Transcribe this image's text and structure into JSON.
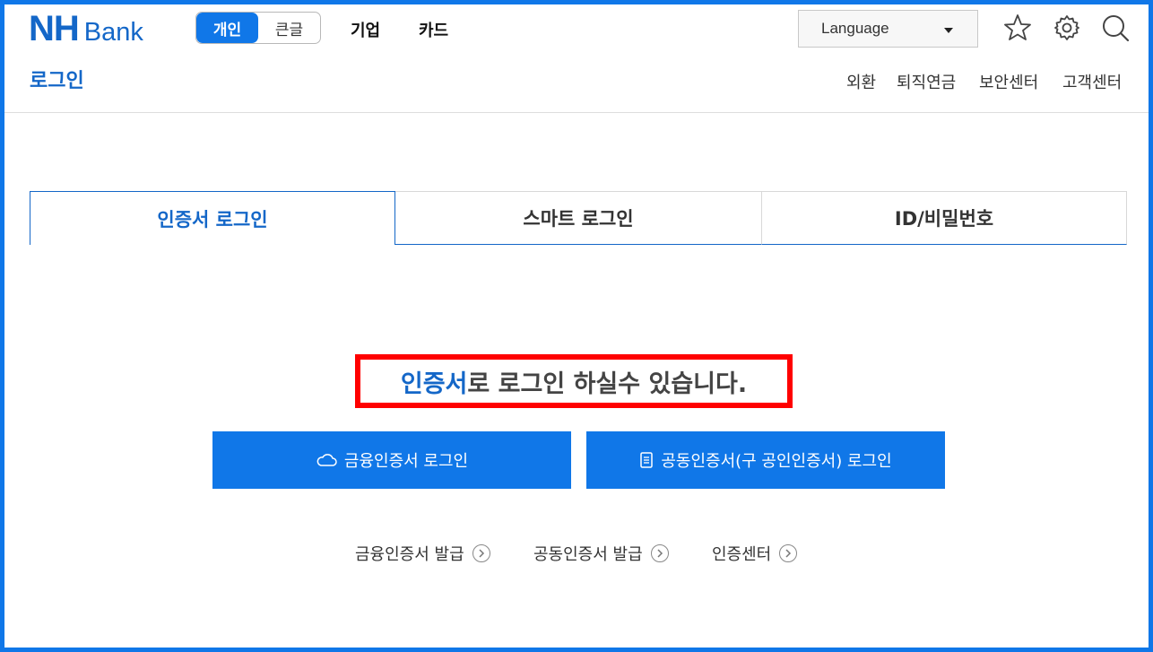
{
  "header": {
    "logo_nh": "NH",
    "logo_bank": "Bank",
    "segment": {
      "active": "개인",
      "inactive": "큰글"
    },
    "top_menu": [
      "기업",
      "카드"
    ],
    "language": {
      "label": "Language"
    },
    "icons": [
      "star-icon",
      "gear-icon",
      "search-icon"
    ],
    "page_title": "로그인",
    "sub_menu": [
      "외환",
      "퇴직연금",
      "보안센터",
      "고객센터"
    ]
  },
  "tabs": [
    {
      "label": "인증서 로그인",
      "active": true
    },
    {
      "label": "스마트 로그인",
      "active": false
    },
    {
      "label": "ID/비밀번호",
      "active": false
    }
  ],
  "message": {
    "highlight": "인증서",
    "rest": "로 로그인 하실수 있습니다."
  },
  "buttons": [
    {
      "label": "금융인증서 로그인",
      "icon": "cloud-icon"
    },
    {
      "label": "공동인증서(구 공인인증서) 로그인",
      "icon": "document-icon"
    }
  ],
  "links": [
    {
      "label": "금융인증서 발급",
      "icon": "chevron-right-circle-icon"
    },
    {
      "label": "공동인증서 발급",
      "icon": "chevron-right-circle-icon"
    },
    {
      "label": "인증센터",
      "icon": "chevron-right-circle-icon"
    }
  ],
  "colors": {
    "brand": "#1467c8",
    "button": "#1077e8",
    "highlight_box": "#ff0000",
    "frame": "#1077e8"
  }
}
